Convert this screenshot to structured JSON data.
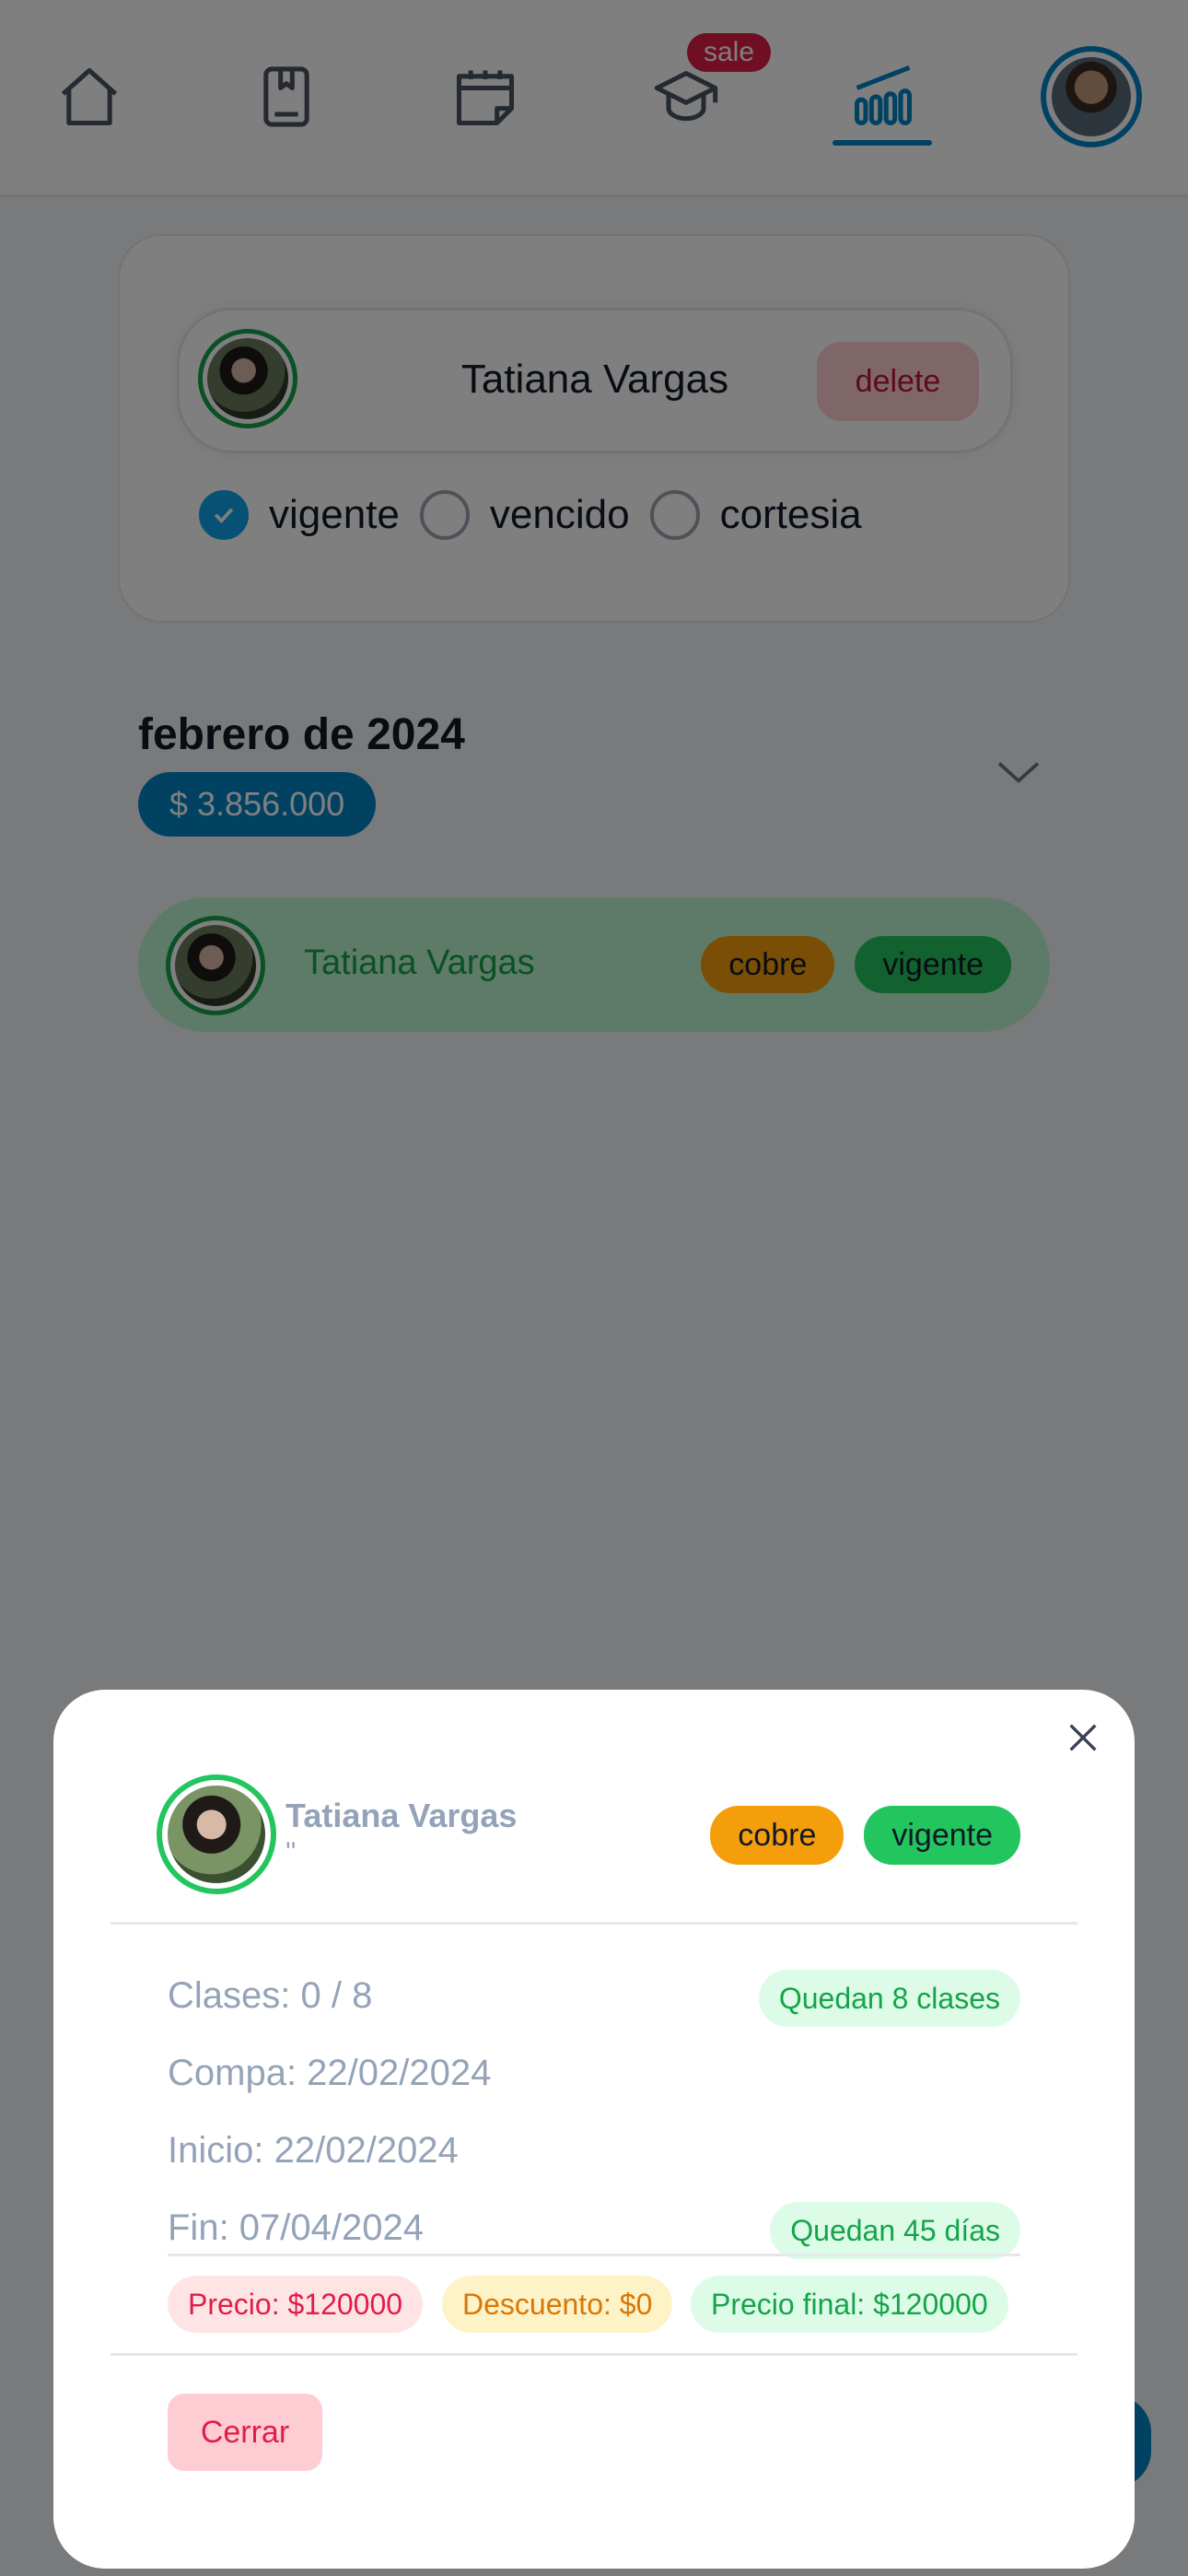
{
  "nav": {
    "items": [
      "home-icon",
      "book-icon",
      "calendar-icon",
      "graduation-cap-icon",
      "stats-icon"
    ],
    "sale_badge": "sale",
    "accent": "#0284c7"
  },
  "filter": {
    "student_name": "Tatiana Vargas",
    "delete_label": "delete",
    "options": [
      {
        "label": "vigente",
        "checked": true
      },
      {
        "label": "vencido",
        "checked": false
      },
      {
        "label": "cortesia",
        "checked": false
      }
    ]
  },
  "month": {
    "title": "febrero de 2024",
    "total": "$ 3.856.000"
  },
  "row": {
    "name": "Tatiana Vargas",
    "tag_cobre": "cobre",
    "tag_vigente": "vigente"
  },
  "modal": {
    "name": "Tatiana Vargas",
    "sub": "''",
    "tag_cobre": "cobre",
    "tag_vigente": "vigente",
    "clases": "Clases: 0 / 8",
    "clases_chip": "Quedan 8 clases",
    "compra": "Compa: 22/02/2024",
    "inicio": "Inicio: 22/02/2024",
    "fin": "Fin: 07/04/2024",
    "fin_chip": "Quedan 45 días",
    "precio": "Precio: $120000",
    "descuento": "Descuento: $0",
    "precio_final": "Precio final: $120000",
    "cerrar_label": "Cerrar"
  },
  "colors": {
    "green": "#22c55e",
    "amber": "#f59e0b",
    "rose": "#e11d48"
  }
}
